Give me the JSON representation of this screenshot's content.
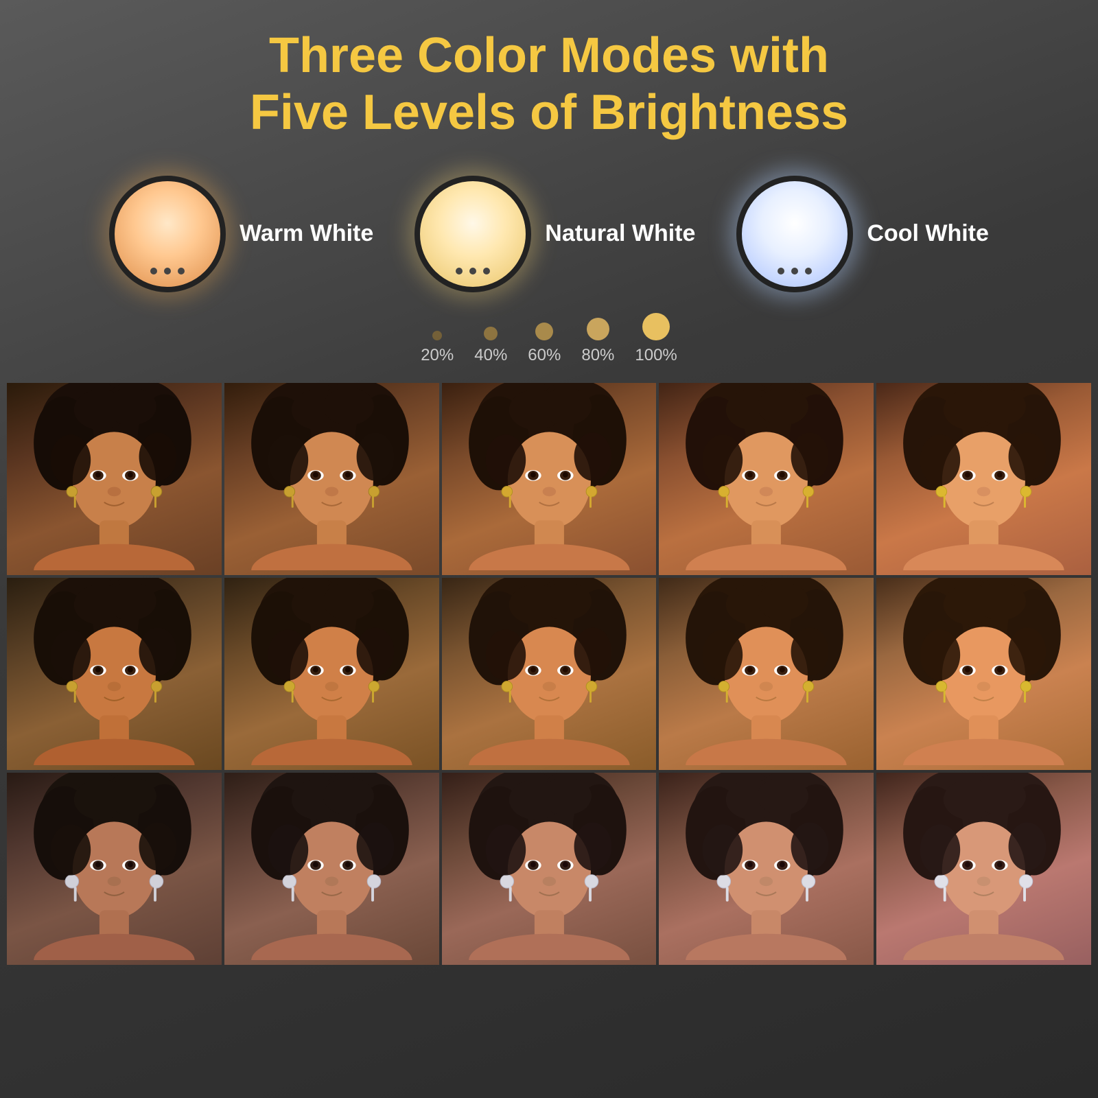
{
  "header": {
    "title_line1": "Three Color Modes with",
    "title_line2": "Five Levels of Brightness"
  },
  "color_modes": [
    {
      "id": "warm",
      "label": "Warm White",
      "circle_class": "light-body-warm"
    },
    {
      "id": "natural",
      "label": "Natural White",
      "circle_class": "light-body-natural"
    },
    {
      "id": "cool",
      "label": "Cool White",
      "circle_class": "light-body-cool"
    }
  ],
  "brightness_levels": [
    {
      "percent": "20%",
      "size": 14
    },
    {
      "percent": "40%",
      "size": 20
    },
    {
      "percent": "60%",
      "size": 26
    },
    {
      "percent": "80%",
      "size": 33
    },
    {
      "percent": "100%",
      "size": 40
    }
  ],
  "grid": {
    "rows": 3,
    "cols": 5
  }
}
